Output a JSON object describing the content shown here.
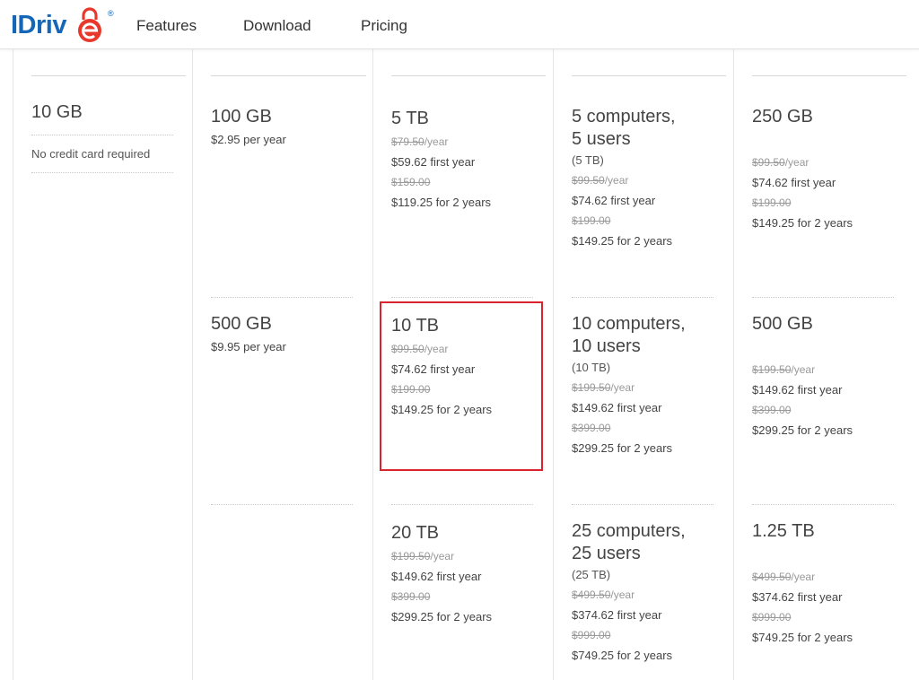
{
  "header": {
    "logo_text": "IDriv",
    "logo_reg": "®",
    "nav": [
      "Features",
      "Download",
      "Pricing"
    ]
  },
  "free": {
    "title": "10 GB",
    "note": "No credit card required"
  },
  "mini": [
    {
      "title": "100 GB",
      "price": "$2.95 per year"
    },
    {
      "title": "500 GB",
      "price": "$9.95 per year"
    }
  ],
  "personal": [
    {
      "title": "5 TB",
      "old1": "$79.50",
      "unit": "/year",
      "first": "$59.62 first year",
      "old2": "$159.00",
      "two": "$119.25 for 2 years"
    },
    {
      "title": "10 TB",
      "old1": "$99.50",
      "unit": "/year",
      "first": "$74.62 first year",
      "old2": "$199.00",
      "two": "$149.25 for 2 years"
    },
    {
      "title": "20 TB",
      "old1": "$199.50",
      "unit": "/year",
      "first": "$149.62 first year",
      "old2": "$399.00",
      "two": "$299.25 for 2 years"
    }
  ],
  "team": [
    {
      "title1": "5 computers,",
      "title2": "5 users",
      "sub": "(5 TB)",
      "old1": "$99.50",
      "unit": "/year",
      "first": "$74.62 first year",
      "old2": "$199.00",
      "two": "$149.25 for 2 years"
    },
    {
      "title1": "10 computers,",
      "title2": "10 users",
      "sub": "(10 TB)",
      "old1": "$199.50",
      "unit": "/year",
      "first": "$149.62 first year",
      "old2": "$399.00",
      "two": "$299.25 for 2 years"
    },
    {
      "title1": "25 computers,",
      "title2": "25 users",
      "sub": "(25 TB)",
      "old1": "$499.50",
      "unit": "/year",
      "first": "$374.62 first year",
      "old2": "$999.00",
      "two": "$749.25 for 2 years"
    }
  ],
  "business": [
    {
      "title": "250 GB",
      "old1": "$99.50",
      "unit": "/year",
      "first": "$74.62 first year",
      "old2": "$199.00",
      "two": "$149.25 for 2 years"
    },
    {
      "title": "500 GB",
      "old1": "$199.50",
      "unit": "/year",
      "first": "$149.62 first year",
      "old2": "$399.00",
      "two": "$299.25 for 2 years"
    },
    {
      "title": "1.25 TB",
      "old1": "$499.50",
      "unit": "/year",
      "first": "$374.62 first year",
      "old2": "$999.00",
      "two": "$749.25 for 2 years"
    }
  ],
  "colors": {
    "brand": "#1566b7",
    "logo_accent": "#e8382b",
    "highlight": "#d9232f"
  }
}
